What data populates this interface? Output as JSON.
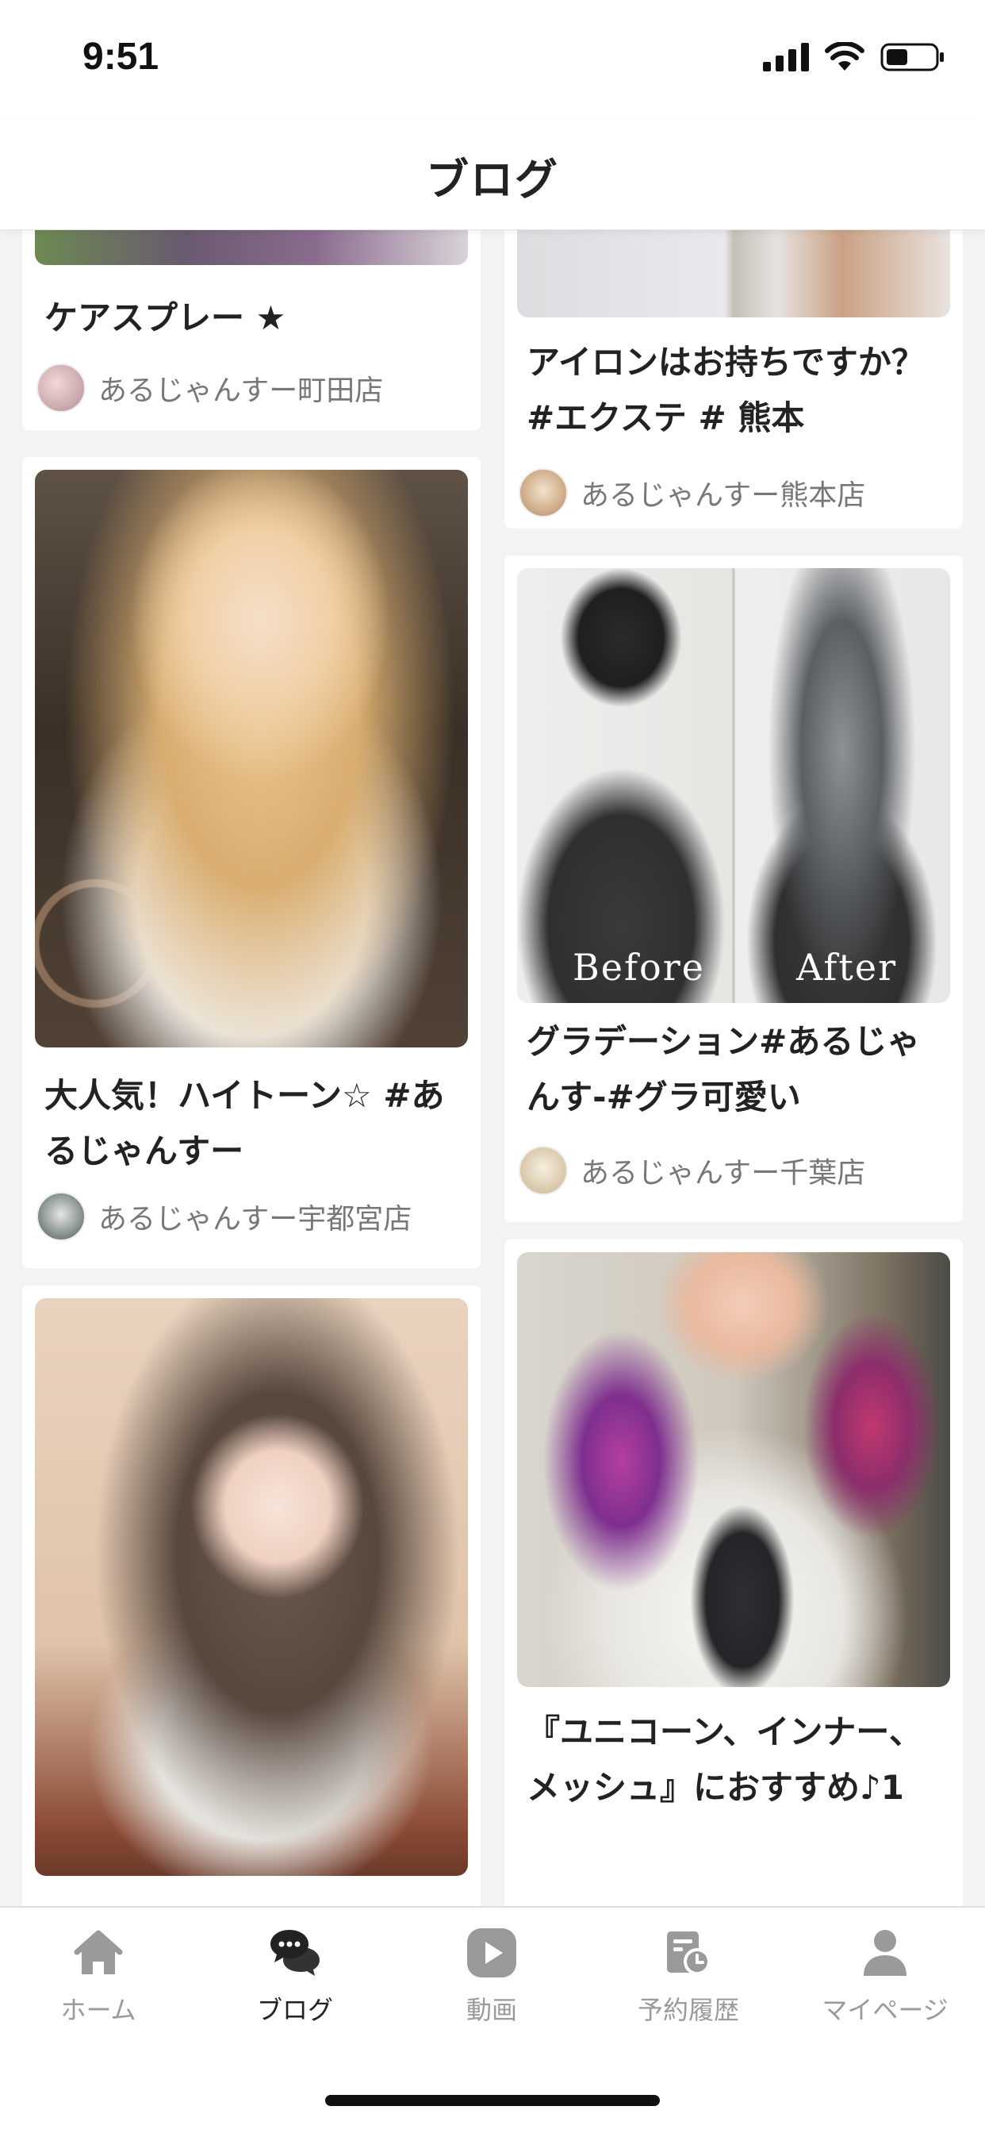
{
  "status_bar": {
    "time": "9:51"
  },
  "nav": {
    "title": "ブログ"
  },
  "cards": [
    {
      "title": "ケアスプレー ★",
      "author": "あるじゃんすー町田店"
    },
    {
      "title": "大人気！ハイトーン☆ #あるじゃんすー",
      "author": "あるじゃんすー宇都宮店"
    },
    {
      "title": "",
      "author": ""
    },
    {
      "title": "アイロンはお持ちですか？ #エクステ # 熊本",
      "author": "あるじゃんすー熊本店"
    },
    {
      "title": "グラデーション#あるじゃんす-#グラ可愛い",
      "author": "あるじゃんすー千葉店",
      "overlay_before": "Before",
      "overlay_after": "After"
    },
    {
      "title": "『ユニコーン、インナー、メッシュ』におすすめ♪1",
      "author": ""
    }
  ],
  "tabs": [
    {
      "label": "ホーム",
      "icon": "home-icon",
      "active": false
    },
    {
      "label": "ブログ",
      "icon": "chat-bubbles-icon",
      "active": true
    },
    {
      "label": "動画",
      "icon": "play-icon",
      "active": false
    },
    {
      "label": "予約履歴",
      "icon": "reservation-history-icon",
      "active": false
    },
    {
      "label": "マイページ",
      "icon": "person-icon",
      "active": false
    }
  ],
  "colors": {
    "accent": "#222222",
    "inactive": "#9a9a9a",
    "background": "#f3f3f3"
  }
}
